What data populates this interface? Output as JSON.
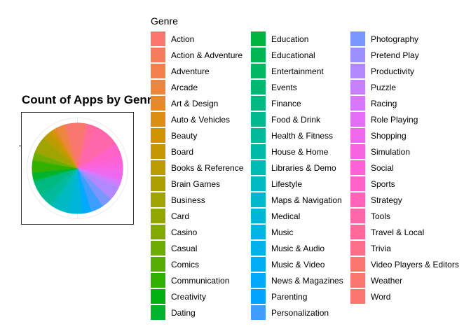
{
  "chart_data": {
    "type": "pie",
    "title": "Count of Apps by Genre",
    "legend_title": "Genre",
    "legend_position": "right",
    "categories": [
      "Action",
      "Action & Adventure",
      "Adventure",
      "Arcade",
      "Art & Design",
      "Auto & Vehicles",
      "Beauty",
      "Board",
      "Books & Reference",
      "Brain Games",
      "Business",
      "Card",
      "Casino",
      "Casual",
      "Comics",
      "Communication",
      "Creativity",
      "Dating",
      "Education",
      "Educational",
      "Entertainment",
      "Events",
      "Finance",
      "Food & Drink",
      "Health & Fitness",
      "House & Home",
      "Libraries & Demo",
      "Lifestyle",
      "Maps & Navigation",
      "Medical",
      "Music",
      "Music & Audio",
      "Music & Video",
      "News & Magazines",
      "Parenting",
      "Personalization",
      "Photography",
      "Pretend Play",
      "Productivity",
      "Puzzle",
      "Racing",
      "Role Playing",
      "Shopping",
      "Simulation",
      "Social",
      "Sports",
      "Strategy",
      "Tools",
      "Travel & Local",
      "Trivia",
      "Video Players & Editors",
      "Weather",
      "Word"
    ],
    "values": [
      365,
      17,
      75,
      220,
      64,
      85,
      53,
      85,
      231,
      6,
      460,
      45,
      39,
      194,
      60,
      387,
      2,
      234,
      20,
      8,
      30,
      64,
      366,
      127,
      306,
      88,
      84,
      373,
      137,
      395,
      1,
      23,
      1,
      283,
      12,
      390,
      335,
      2,
      424,
      124,
      98,
      83,
      260,
      202,
      295,
      398,
      2,
      843,
      258,
      38,
      175,
      82,
      29
    ],
    "colors": [
      "#F8766D",
      "#F57B5E",
      "#F1804E",
      "#EC853D",
      "#E48A2A",
      "#DB8E13",
      "#D19300",
      "#C69800",
      "#BA9C00",
      "#AE9F00",
      "#A0A300",
      "#92A600",
      "#81A900",
      "#6DAC00",
      "#55AE00",
      "#32B000",
      "#00B210",
      "#00B32E",
      "#00B441",
      "#00B652",
      "#00B762",
      "#00B872",
      "#00B980",
      "#00B98D",
      "#00BA9B",
      "#00BAA8",
      "#00BAB5",
      "#00B9C1",
      "#00B8CD",
      "#00B6D8",
      "#00B4E3",
      "#00B1EC",
      "#00ADF5",
      "#00A9FC",
      "#00A4FF",
      "#3D9EFF",
      "#7997FF",
      "#9A90FF",
      "#B388FF",
      "#C780FF",
      "#D777FE",
      "#E46FF6",
      "#EF67ED",
      "#F764E2",
      "#FC61D5",
      "#FF62C8",
      "#FF64B9",
      "#FF67AA",
      "#FF6A9A",
      "#FD6F89",
      "#F8766D",
      "#F8766D",
      "#F8766D"
    ]
  }
}
